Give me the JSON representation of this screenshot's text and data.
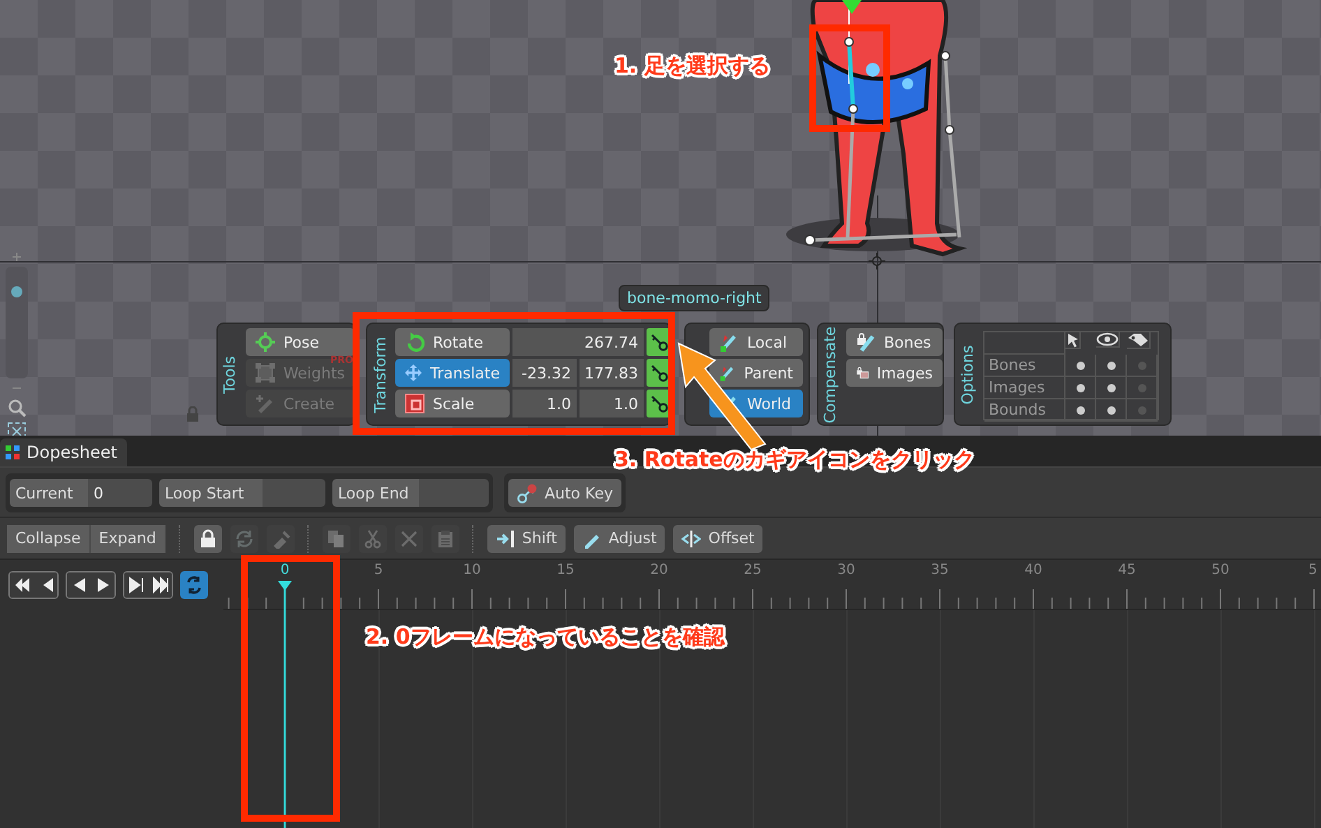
{
  "viewport": {
    "bone_label": "bone-momo-right",
    "zoom": {
      "level": 0.8
    }
  },
  "tools": {
    "title": "Tools",
    "items": [
      {
        "label": "Pose",
        "disabled": false
      },
      {
        "label": "Weights",
        "disabled": true,
        "badge": "PRO"
      },
      {
        "label": "Create",
        "disabled": true
      }
    ]
  },
  "transform": {
    "title": "Transform",
    "rows": [
      {
        "label": "Rotate",
        "selected": false,
        "values": [
          "267.74"
        ]
      },
      {
        "label": "Translate",
        "selected": true,
        "values": [
          "-23.32",
          "177.83"
        ]
      },
      {
        "label": "Scale",
        "selected": false,
        "values": [
          "1.0",
          "1.0"
        ]
      }
    ]
  },
  "axes": [
    {
      "label": "Local",
      "selected": false
    },
    {
      "label": "Parent",
      "selected": false
    },
    {
      "label": "World",
      "selected": true
    }
  ],
  "compensate": {
    "title": "Compensate",
    "items": [
      {
        "label": "Bones"
      },
      {
        "label": "Images"
      }
    ]
  },
  "options": {
    "title": "Options",
    "rows": [
      {
        "label": "Bones",
        "cells": [
          true,
          true,
          false
        ]
      },
      {
        "label": "Images",
        "cells": [
          true,
          true,
          false
        ]
      },
      {
        "label": "Bounds",
        "cells": [
          true,
          true,
          false
        ]
      }
    ]
  },
  "dopesheet": {
    "tab": "Dopesheet",
    "fields": [
      {
        "label": "Current",
        "value": "0"
      },
      {
        "label": "Loop Start"
      },
      {
        "label": "Loop End"
      }
    ],
    "auto_key": {
      "label": "Auto Key"
    },
    "toolbar": [
      {
        "items": [
          {
            "kind": "text",
            "label": "Collapse",
            "disabled": false
          },
          {
            "kind": "text",
            "label": "Expand",
            "disabled": false
          }
        ]
      },
      {
        "items": [
          {
            "kind": "icon",
            "disabled": false
          },
          {
            "kind": "icon",
            "disabled": true
          },
          {
            "kind": "icon",
            "disabled": true
          }
        ]
      },
      {
        "items": [
          {
            "kind": "icon",
            "disabled": true
          },
          {
            "kind": "icon",
            "disabled": true
          },
          {
            "kind": "icon",
            "disabled": true
          },
          {
            "kind": "icon",
            "disabled": true
          }
        ]
      },
      {
        "items": [
          {
            "kind": "text",
            "label": "Shift",
            "disabled": false
          },
          {
            "kind": "text",
            "label": "Adjust",
            "disabled": false
          },
          {
            "kind": "text",
            "label": "Offset",
            "disabled": false
          }
        ]
      }
    ]
  },
  "timeline": {
    "loop": true,
    "playhead_label": "0",
    "ruler_labels": [
      "5",
      "10",
      "15",
      "20",
      "25",
      "30",
      "35",
      "40",
      "45",
      "50",
      "5"
    ]
  },
  "annotations": [
    {
      "text": "1. 足を選択する"
    },
    {
      "text": "3. Rotateのカギアイコンをクリック"
    },
    {
      "text": "2. 0フレームになっていることを確認"
    }
  ]
}
